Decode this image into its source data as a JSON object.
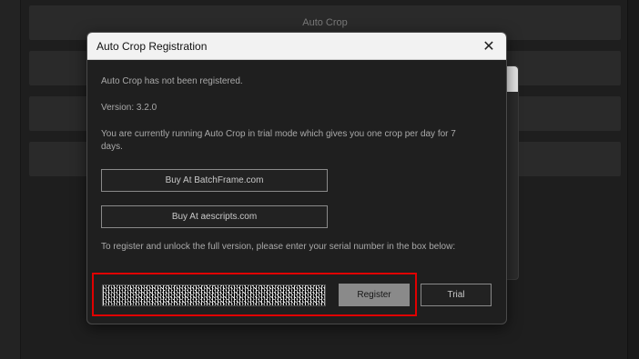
{
  "background": {
    "panel_title": "Auto Crop"
  },
  "dialog": {
    "title": "Auto Crop Registration",
    "close_label": "✕",
    "status_text": "Auto Crop has not been registered.",
    "version_text": "Version: 3.2.0",
    "trial_info": "You are currently running Auto Crop in trial mode which gives you one crop per day for 7 days.",
    "buy_batchframe_label": "Buy At BatchFrame.com",
    "buy_aescripts_label": "Buy At aescripts.com",
    "register_instructions": "To register and unlock the full version, please enter your serial number in the box below:",
    "serial_value": "",
    "register_label": "Register",
    "trial_label": "Trial"
  },
  "colors": {
    "highlight": "#e00000",
    "dialog_bg": "#1f1f1f",
    "titlebar_bg": "#f2f2f2"
  },
  "icons": {
    "close": "close-icon"
  }
}
